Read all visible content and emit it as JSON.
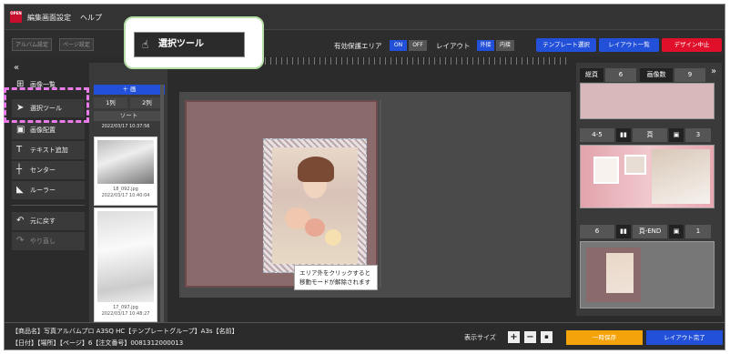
{
  "titlebar": {
    "logo": "OPEN\nTEXT",
    "menu1": "編集画面設定",
    "menu2": "ヘルプ"
  },
  "toolbar": {
    "album_settings": "アルバム設定",
    "page_settings": "ページ設定",
    "safe_area_label": "有効保護エリア",
    "on": "ON",
    "off": "OFF",
    "layout_label": "レイアウト",
    "outer": "外接",
    "inner": "内接",
    "template_select": "テンプレート選択",
    "layout_list": "レイアウト一覧",
    "design_cancel": "デザイン中止"
  },
  "callout": {
    "label": "選択ツール"
  },
  "sidebar": {
    "collapse": "«",
    "items": [
      {
        "label": "画像一覧"
      },
      {
        "label": "選択ツール"
      },
      {
        "label": "画像配置"
      },
      {
        "label": "テキスト追加"
      },
      {
        "label": "センター"
      },
      {
        "label": "ルーラー"
      },
      {
        "label": "元に戻す"
      },
      {
        "label": "やり直し"
      }
    ]
  },
  "thumbs": {
    "add_label": "＋ 画",
    "one_col": "1列",
    "two_col": "2列",
    "sort": "ソート",
    "date_top": "2022/03/17 10:37:56",
    "img1_name": "18_092.jpg",
    "img1_date": "2022/03/17 10:40:04",
    "img2_name": "17_097.jpg",
    "img2_date": "2022/03/17 10:48:27"
  },
  "canvas": {
    "tip_line1": "エリア外をクリックすると",
    "tip_line2": "移動モードが解除されます"
  },
  "right_panel": {
    "total_label": "総頁",
    "total_value": "6",
    "image_count_label": "画像数",
    "image_count_value": "9",
    "expand": "»",
    "spread_label": "4-5",
    "page_label": "頁",
    "spread_count": "3",
    "last_label": "6",
    "last_page": "頁-END",
    "last_count": "1"
  },
  "bottom": {
    "line1": "【商品名】写真アルバムプロ A3SQ HC【テンプレートグループ】A3s【名前】",
    "line2": "【日付】【場所】【ページ】6【注文番号】0081312000013",
    "zoom_label": "表示サイズ",
    "zoom_plus": "+",
    "zoom_minus": "−",
    "zoom_fit": "▪",
    "temp_save": "一時保存",
    "layout_done": "レイアウト完了"
  },
  "colors": {
    "accent_blue": "#2350d8",
    "temp_save": "#f5a30a",
    "cancel_red": "#e0102a",
    "highlight": "#e87ce8"
  }
}
